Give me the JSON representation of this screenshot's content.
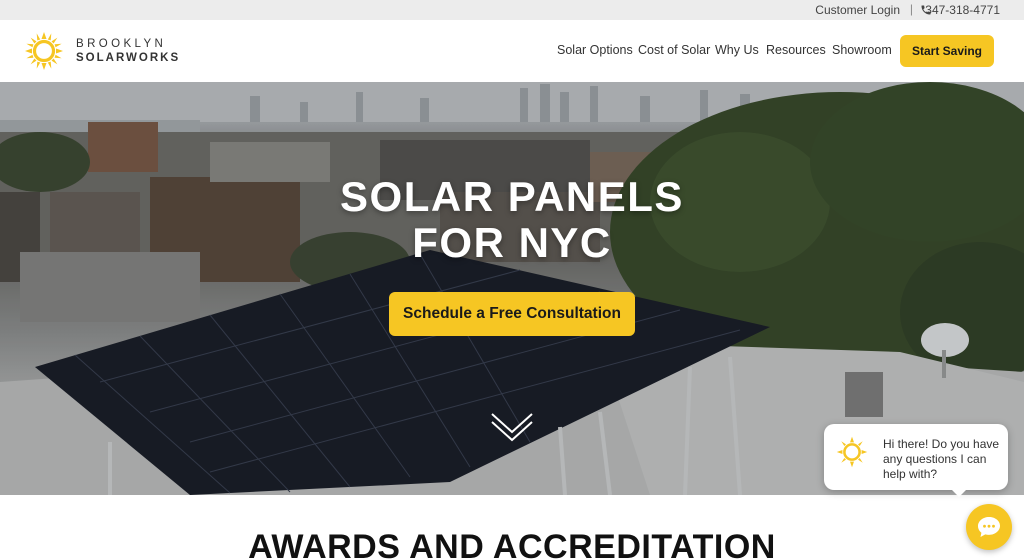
{
  "topbar": {
    "customer_login": "Customer Login",
    "separator": "|",
    "phone": "347-318-4771",
    "phone_icon": "phone-icon"
  },
  "header": {
    "logo_line1": "BROOKLYN",
    "logo_line2": "SOLARWORKS",
    "nav": [
      "Solar Options",
      "Cost of Solar",
      "Why Us",
      "Resources",
      "Showroom"
    ],
    "cta": "Start Saving"
  },
  "hero": {
    "title_line1": "SOLAR PANELS",
    "title_line2": "FOR NYC",
    "cta": "Schedule a Free Consultation",
    "scroll_icon": "chevron-down-icon"
  },
  "chat": {
    "message": "Hi there! Do you have any questions I can help with?",
    "launcher_icon": "chat-icon"
  },
  "main": {
    "section_heading": "AWARDS AND ACCREDITATION"
  },
  "colors": {
    "accent": "#f6c623",
    "topbar_bg": "#ececec",
    "text": "#333333"
  }
}
